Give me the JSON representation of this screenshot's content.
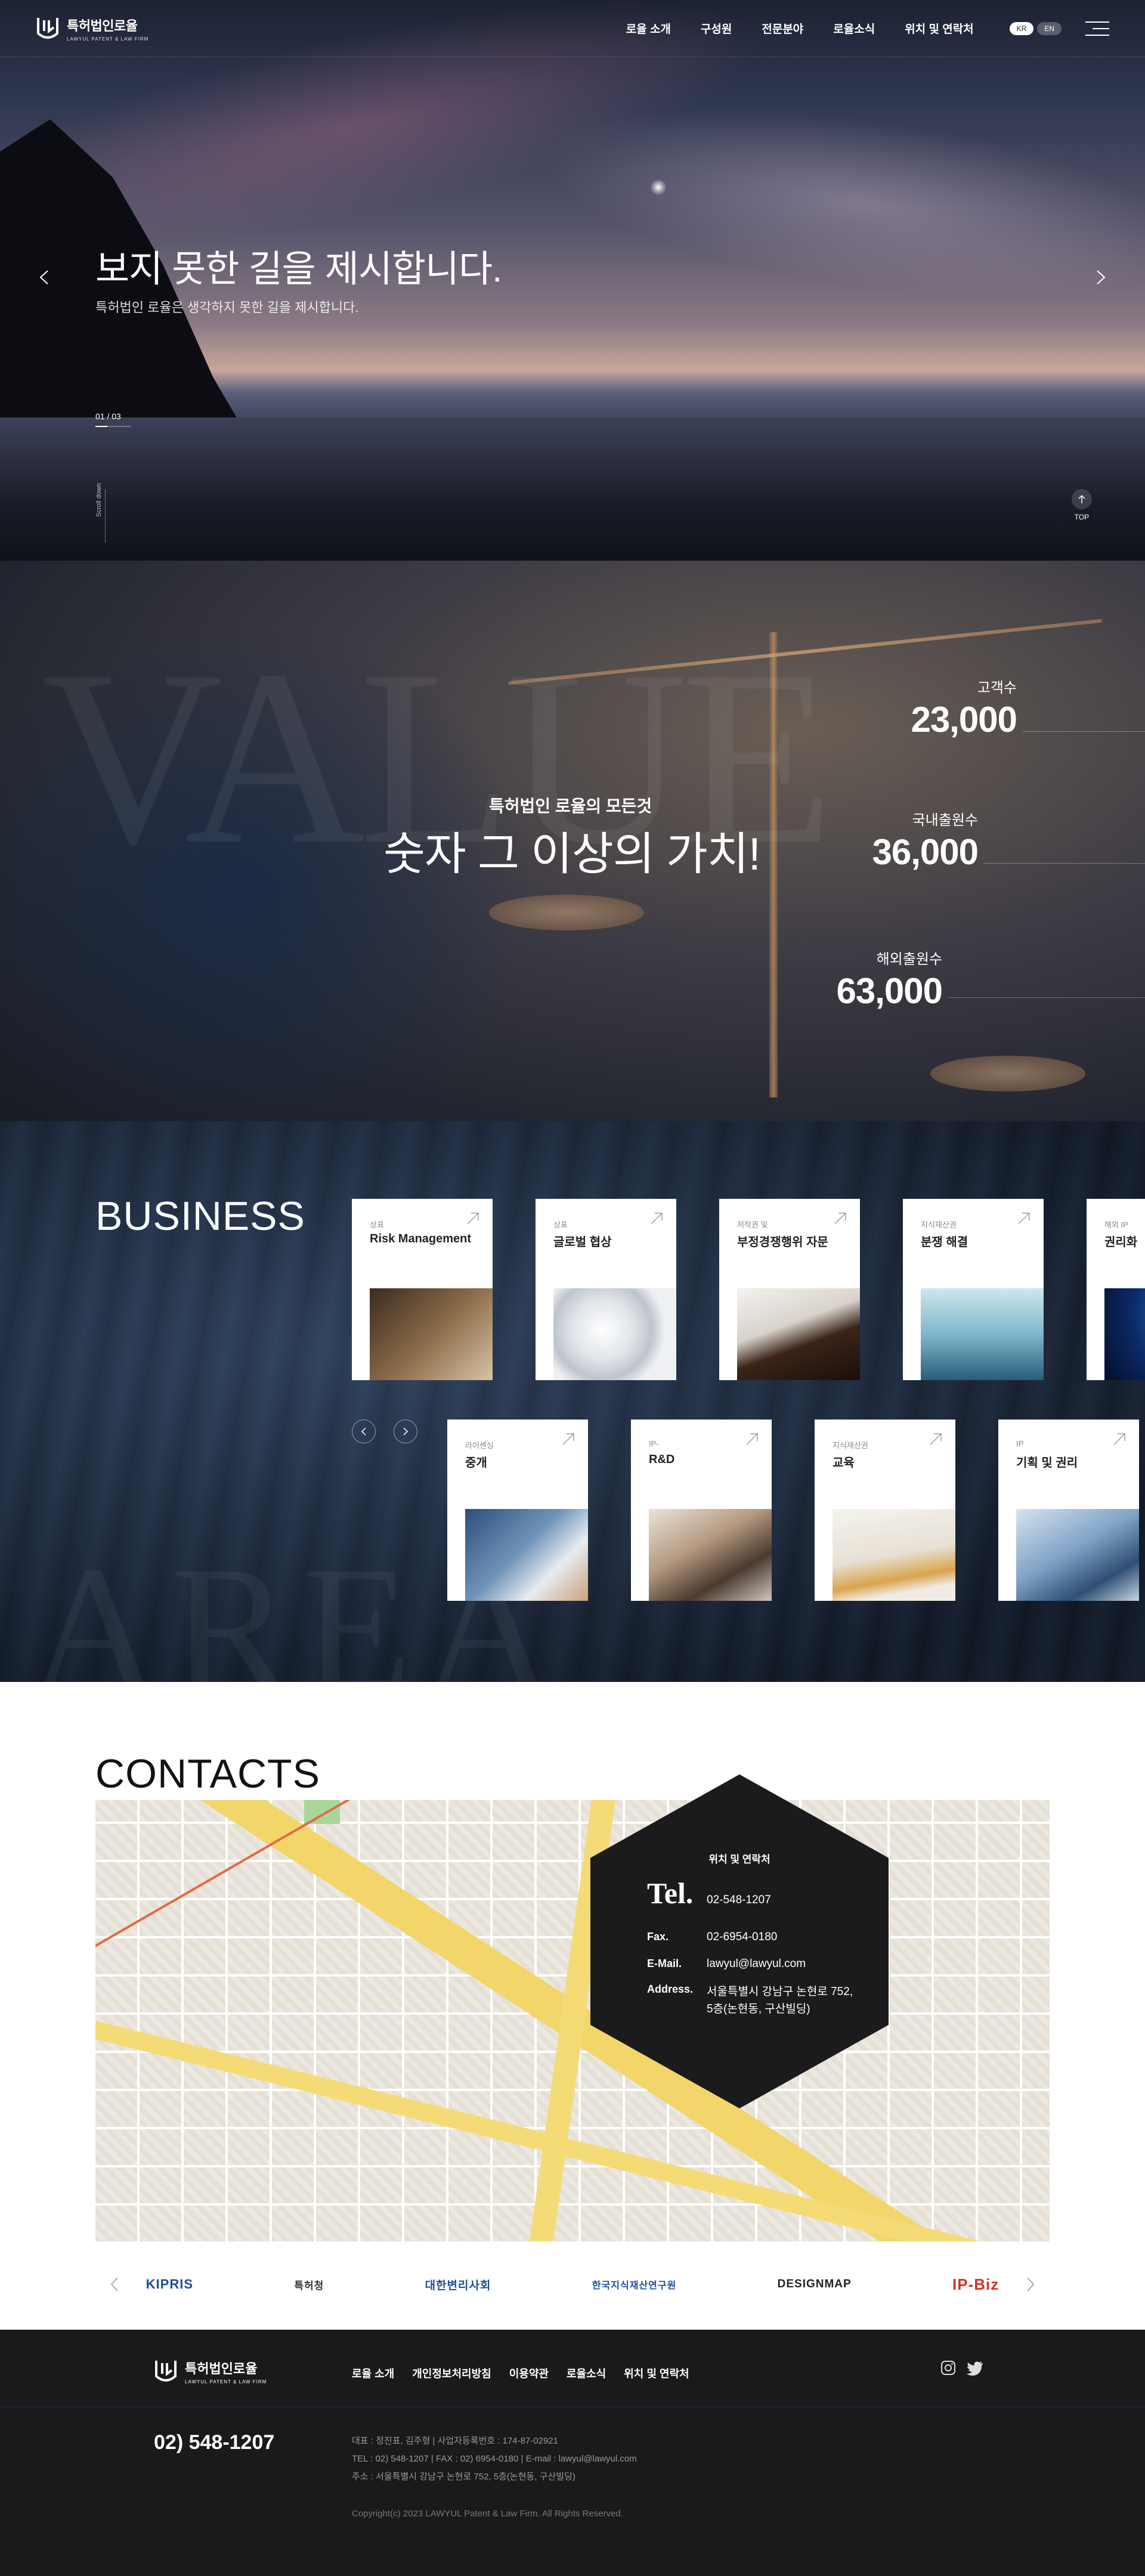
{
  "header": {
    "logo_ko": "특허법인로율",
    "logo_en": "LAWYUL PATENT & LAW FIRM",
    "nav": [
      "로율 소개",
      "구성원",
      "전문분야",
      "로율소식",
      "위치 및 연락처"
    ],
    "lang": [
      "KR",
      "EN"
    ]
  },
  "hero": {
    "title": "보지 못한 길을 제시합니다.",
    "subtitle": "특허법인 로율은 생각하지 못한 길을 제시합니다.",
    "pager": "01 / 03",
    "slide_current": 1,
    "slide_total": 3,
    "scroll_label": "Scroll down",
    "top_label": "TOP"
  },
  "value": {
    "watermark": "VALUE",
    "kicker": "특허법인 로율의 모든것",
    "title": "숫자 그 이상의 가치!",
    "stats": [
      {
        "label": "고객수",
        "value": "23,000"
      },
      {
        "label": "국내출원수",
        "value": "36,000"
      },
      {
        "label": "해외출원수",
        "value": "63,000"
      }
    ]
  },
  "business": {
    "title": "BUSINESS",
    "watermark": "AREA",
    "row1": [
      {
        "cat": "상표",
        "name": "Risk Management"
      },
      {
        "cat": "상표",
        "name": "글로벌 협상"
      },
      {
        "cat": "저작권 및",
        "name": "부정경쟁행위 자문"
      },
      {
        "cat": "지식재산권",
        "name": "분쟁 해결"
      },
      {
        "cat": "해외 IP",
        "name": "권리화"
      }
    ],
    "row2": [
      {
        "cat": "라이센싱",
        "name": "중개"
      },
      {
        "cat": "IP-",
        "name": "R&D"
      },
      {
        "cat": "지식재산권",
        "name": "교육"
      },
      {
        "cat": "IP",
        "name": "기획 및 권리"
      }
    ]
  },
  "contacts": {
    "title": "CONTACTS",
    "box_title": "위치 및 연락처",
    "tel_label": "Tel.",
    "tel": "02-548-1207",
    "fax_label": "Fax.",
    "fax": "02-6954-0180",
    "email_label": "E-Mail.",
    "email": "lawyul@lawyul.com",
    "address_label": "Address.",
    "address_line1": "서울특별시 강남구 논현로 752,",
    "address_line2": "5층(논현동, 구산빌딩)"
  },
  "partners": [
    "KIPRIS",
    "특허청",
    "대한변리사회",
    "한국지식재산연구원",
    "DESIGNMAP",
    "IP-Biz"
  ],
  "colors": {
    "partner_red": "#d8331c",
    "partner_blue": "#1d4e9c",
    "footer_bg": "#1a1a1d"
  },
  "footer": {
    "logo_ko": "특허법인로율",
    "logo_en": "LAWYUL PATENT & LAW FIRM",
    "nav": [
      "로율 소개",
      "개인정보처리방침",
      "이용약관",
      "로율소식",
      "위치 및 연락처"
    ],
    "phone": "02) 548-1207",
    "info_line1": "대표 : 정진표, 김주형  |  사업자등록번호 : 174-87-02921",
    "info_line2": "TEL : 02) 548-1207  |  FAX : 02) 6954-0180  |  E-mail : lawyul@lawyul.com",
    "info_line3": "주소 : 서울특별시 강남구 논현로 752, 5층(논현동, 구산빌딩)",
    "copyright": "Copyright(c) 2023 LAWYUL Patent & Law Firm. All Rights Reserved."
  }
}
